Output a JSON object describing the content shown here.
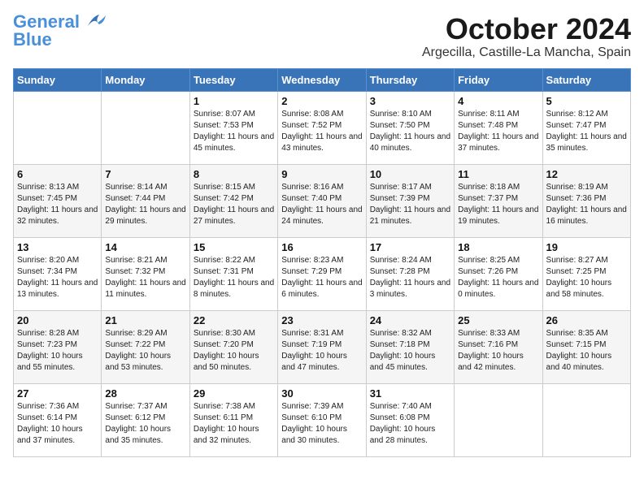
{
  "logo": {
    "line1": "General",
    "line2": "Blue"
  },
  "title": "October 2024",
  "location": "Argecilla, Castille-La Mancha, Spain",
  "weekdays": [
    "Sunday",
    "Monday",
    "Tuesday",
    "Wednesday",
    "Thursday",
    "Friday",
    "Saturday"
  ],
  "weeks": [
    [
      {
        "day": "",
        "info": ""
      },
      {
        "day": "",
        "info": ""
      },
      {
        "day": "1",
        "info": "Sunrise: 8:07 AM\nSunset: 7:53 PM\nDaylight: 11 hours and 45 minutes."
      },
      {
        "day": "2",
        "info": "Sunrise: 8:08 AM\nSunset: 7:52 PM\nDaylight: 11 hours and 43 minutes."
      },
      {
        "day": "3",
        "info": "Sunrise: 8:10 AM\nSunset: 7:50 PM\nDaylight: 11 hours and 40 minutes."
      },
      {
        "day": "4",
        "info": "Sunrise: 8:11 AM\nSunset: 7:48 PM\nDaylight: 11 hours and 37 minutes."
      },
      {
        "day": "5",
        "info": "Sunrise: 8:12 AM\nSunset: 7:47 PM\nDaylight: 11 hours and 35 minutes."
      }
    ],
    [
      {
        "day": "6",
        "info": "Sunrise: 8:13 AM\nSunset: 7:45 PM\nDaylight: 11 hours and 32 minutes."
      },
      {
        "day": "7",
        "info": "Sunrise: 8:14 AM\nSunset: 7:44 PM\nDaylight: 11 hours and 29 minutes."
      },
      {
        "day": "8",
        "info": "Sunrise: 8:15 AM\nSunset: 7:42 PM\nDaylight: 11 hours and 27 minutes."
      },
      {
        "day": "9",
        "info": "Sunrise: 8:16 AM\nSunset: 7:40 PM\nDaylight: 11 hours and 24 minutes."
      },
      {
        "day": "10",
        "info": "Sunrise: 8:17 AM\nSunset: 7:39 PM\nDaylight: 11 hours and 21 minutes."
      },
      {
        "day": "11",
        "info": "Sunrise: 8:18 AM\nSunset: 7:37 PM\nDaylight: 11 hours and 19 minutes."
      },
      {
        "day": "12",
        "info": "Sunrise: 8:19 AM\nSunset: 7:36 PM\nDaylight: 11 hours and 16 minutes."
      }
    ],
    [
      {
        "day": "13",
        "info": "Sunrise: 8:20 AM\nSunset: 7:34 PM\nDaylight: 11 hours and 13 minutes."
      },
      {
        "day": "14",
        "info": "Sunrise: 8:21 AM\nSunset: 7:32 PM\nDaylight: 11 hours and 11 minutes."
      },
      {
        "day": "15",
        "info": "Sunrise: 8:22 AM\nSunset: 7:31 PM\nDaylight: 11 hours and 8 minutes."
      },
      {
        "day": "16",
        "info": "Sunrise: 8:23 AM\nSunset: 7:29 PM\nDaylight: 11 hours and 6 minutes."
      },
      {
        "day": "17",
        "info": "Sunrise: 8:24 AM\nSunset: 7:28 PM\nDaylight: 11 hours and 3 minutes."
      },
      {
        "day": "18",
        "info": "Sunrise: 8:25 AM\nSunset: 7:26 PM\nDaylight: 11 hours and 0 minutes."
      },
      {
        "day": "19",
        "info": "Sunrise: 8:27 AM\nSunset: 7:25 PM\nDaylight: 10 hours and 58 minutes."
      }
    ],
    [
      {
        "day": "20",
        "info": "Sunrise: 8:28 AM\nSunset: 7:23 PM\nDaylight: 10 hours and 55 minutes."
      },
      {
        "day": "21",
        "info": "Sunrise: 8:29 AM\nSunset: 7:22 PM\nDaylight: 10 hours and 53 minutes."
      },
      {
        "day": "22",
        "info": "Sunrise: 8:30 AM\nSunset: 7:20 PM\nDaylight: 10 hours and 50 minutes."
      },
      {
        "day": "23",
        "info": "Sunrise: 8:31 AM\nSunset: 7:19 PM\nDaylight: 10 hours and 47 minutes."
      },
      {
        "day": "24",
        "info": "Sunrise: 8:32 AM\nSunset: 7:18 PM\nDaylight: 10 hours and 45 minutes."
      },
      {
        "day": "25",
        "info": "Sunrise: 8:33 AM\nSunset: 7:16 PM\nDaylight: 10 hours and 42 minutes."
      },
      {
        "day": "26",
        "info": "Sunrise: 8:35 AM\nSunset: 7:15 PM\nDaylight: 10 hours and 40 minutes."
      }
    ],
    [
      {
        "day": "27",
        "info": "Sunrise: 7:36 AM\nSunset: 6:14 PM\nDaylight: 10 hours and 37 minutes."
      },
      {
        "day": "28",
        "info": "Sunrise: 7:37 AM\nSunset: 6:12 PM\nDaylight: 10 hours and 35 minutes."
      },
      {
        "day": "29",
        "info": "Sunrise: 7:38 AM\nSunset: 6:11 PM\nDaylight: 10 hours and 32 minutes."
      },
      {
        "day": "30",
        "info": "Sunrise: 7:39 AM\nSunset: 6:10 PM\nDaylight: 10 hours and 30 minutes."
      },
      {
        "day": "31",
        "info": "Sunrise: 7:40 AM\nSunset: 6:08 PM\nDaylight: 10 hours and 28 minutes."
      },
      {
        "day": "",
        "info": ""
      },
      {
        "day": "",
        "info": ""
      }
    ]
  ]
}
